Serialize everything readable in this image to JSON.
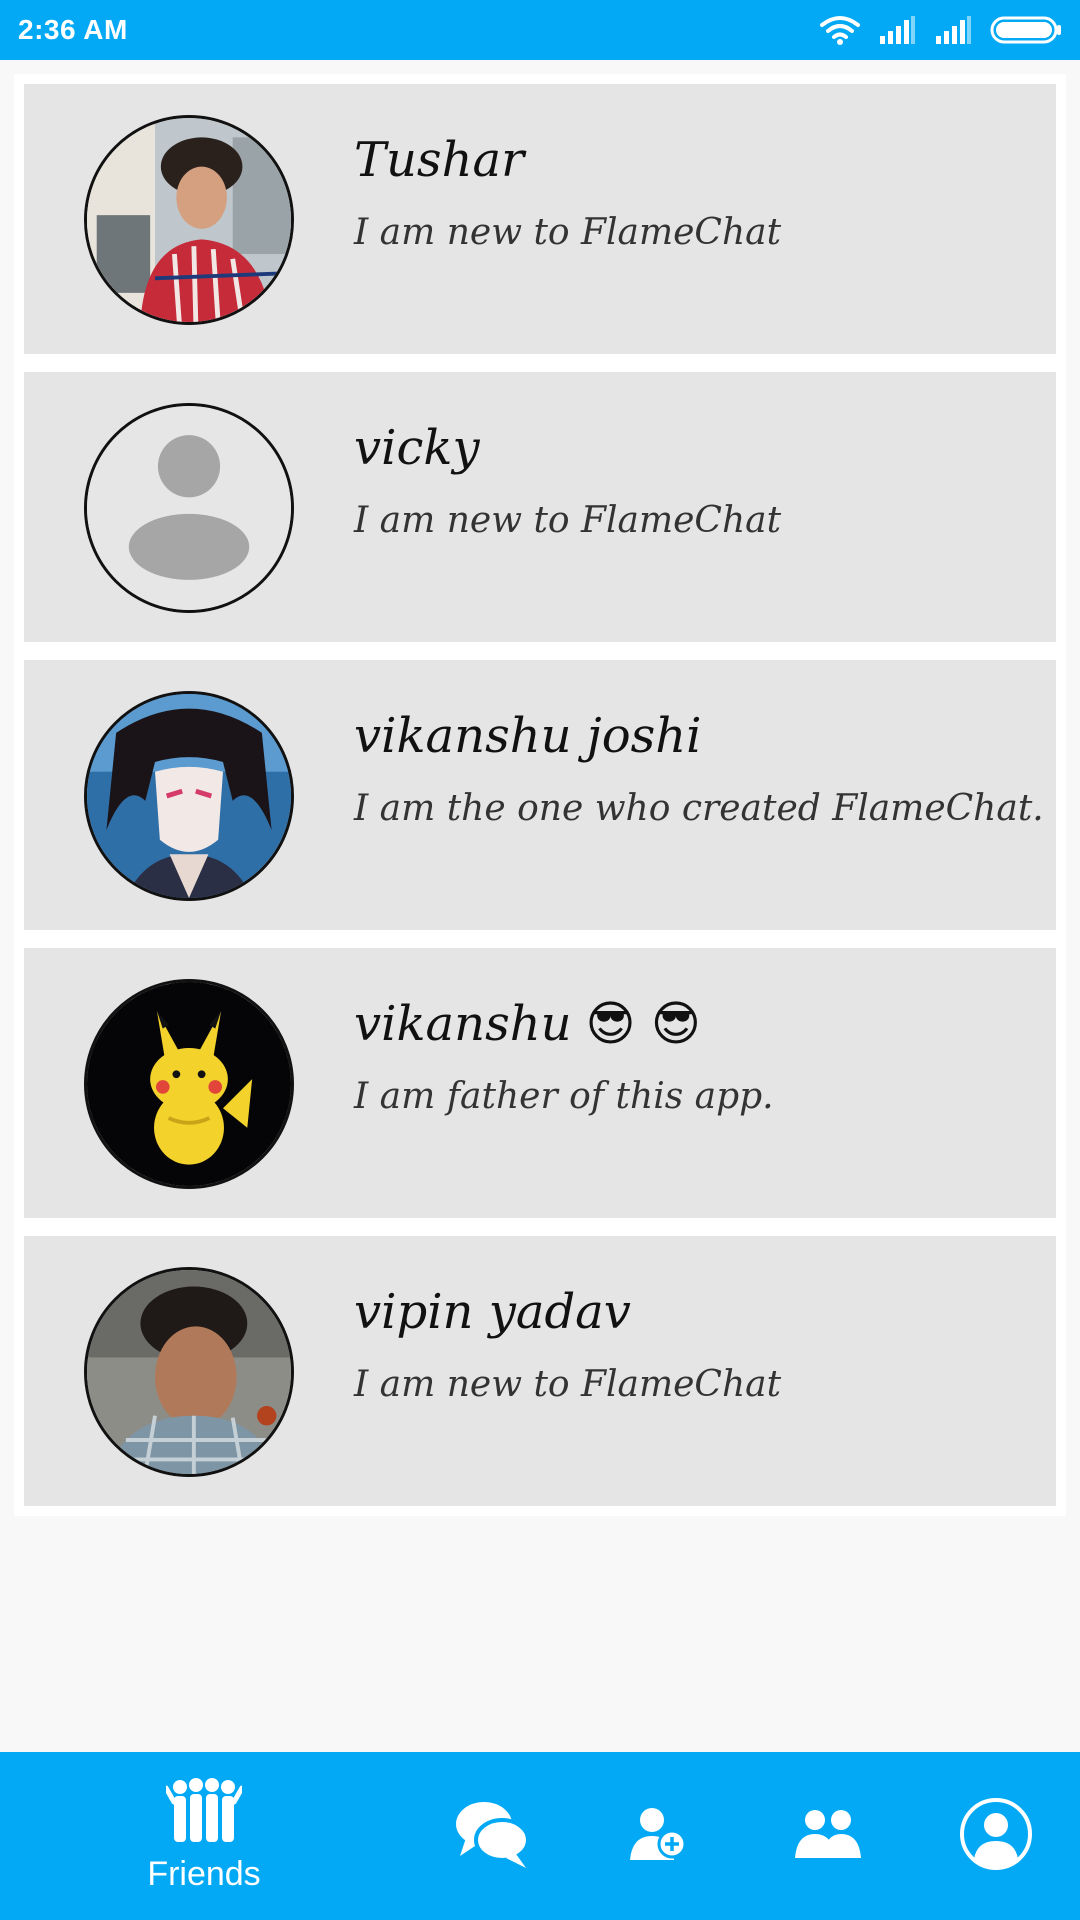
{
  "status_bar": {
    "time": "2:36 AM",
    "icons": [
      "wifi-icon",
      "signal-icon",
      "signal-icon",
      "battery-icon"
    ]
  },
  "friends": [
    {
      "name": "Tushar",
      "status": "I am new to FlameChat",
      "avatar": "photo-man-red-shirt"
    },
    {
      "name": "vicky",
      "status": "I am new to FlameChat",
      "avatar": "default-user-placeholder"
    },
    {
      "name": "vikanshu joshi",
      "status": "I am the one who created FlameChat.",
      "avatar": "anime-character"
    },
    {
      "name": "vikanshu",
      "name_emoji": "😎 😎",
      "status": "I am father of this app.",
      "avatar": "pikachu"
    },
    {
      "name": "vipin yadav",
      "status": "I am new to FlameChat",
      "avatar": "photo-man-plaid-shirt"
    }
  ],
  "bottom_nav": {
    "items": [
      {
        "label": "Friends",
        "icon": "friends-group-icon",
        "active": true
      },
      {
        "label": "",
        "icon": "chats-icon"
      },
      {
        "label": "",
        "icon": "add-friend-icon"
      },
      {
        "label": "",
        "icon": "requests-icon"
      },
      {
        "label": "",
        "icon": "profile-icon"
      }
    ]
  },
  "colors": {
    "accent": "#03a9f4",
    "card": "#e5e5e5",
    "background": "#f8f8f8"
  }
}
